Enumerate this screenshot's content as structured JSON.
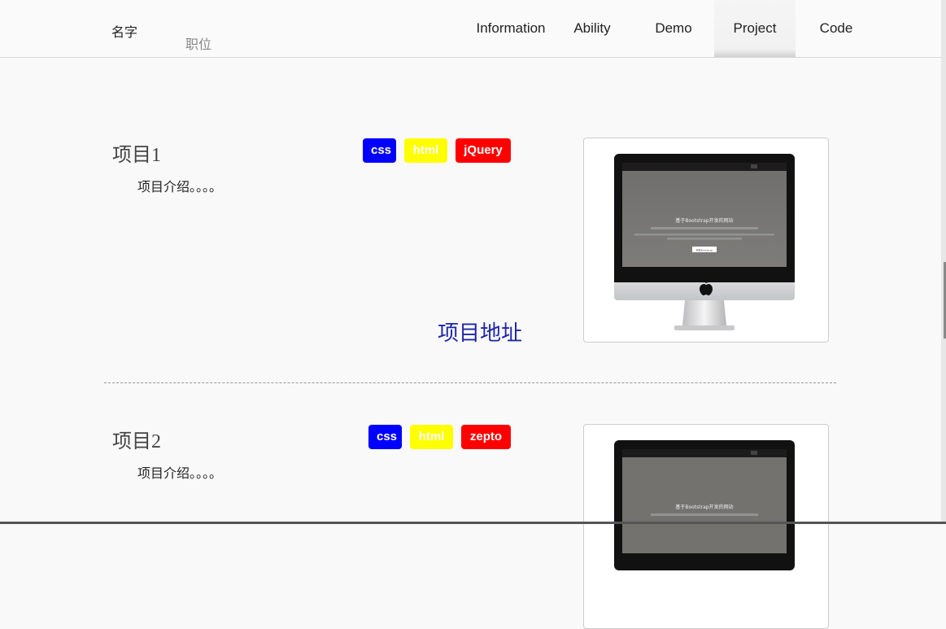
{
  "header": {
    "name": "名字",
    "title": "职位",
    "nav": [
      {
        "label": "Information"
      },
      {
        "label": "Ability"
      },
      {
        "label": "Demo"
      },
      {
        "label": "Project"
      },
      {
        "label": "Code"
      }
    ],
    "active_nav": "Project"
  },
  "projects": [
    {
      "title": "项目1",
      "description": "项目介绍。。。。",
      "tags": [
        {
          "label": "css",
          "color": "#0000ff"
        },
        {
          "label": "html",
          "color": "#ffff00"
        },
        {
          "label": "jQuery",
          "color": "#ff0000"
        }
      ],
      "link_label": "项目地址",
      "thumbnail": {
        "heading": "基于Bootstrap开发的网站",
        "button": "获取Bootstrap"
      }
    },
    {
      "title": "项目2",
      "description": "项目介绍。。。。",
      "tags": [
        {
          "label": "css",
          "color": "#0000ff"
        },
        {
          "label": "html",
          "color": "#ffff00"
        },
        {
          "label": "zepto",
          "color": "#ff0000"
        }
      ],
      "thumbnail": {
        "heading": "基于Bootstrap开发的网站"
      }
    }
  ]
}
